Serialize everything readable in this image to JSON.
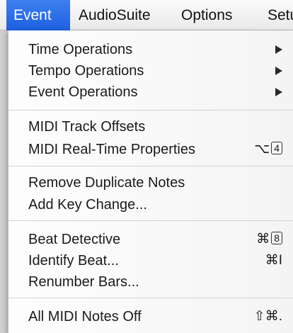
{
  "menubar": {
    "items": [
      {
        "label": "Event",
        "active": true
      },
      {
        "label": "AudioSuite",
        "active": false
      },
      {
        "label": "Options",
        "active": false
      },
      {
        "label": "Setu",
        "active": false
      }
    ]
  },
  "menu": {
    "title": "Event",
    "groups": [
      {
        "items": [
          {
            "label": "Time Operations",
            "submenu": true
          },
          {
            "label": "Tempo Operations",
            "submenu": true
          },
          {
            "label": "Event Operations",
            "submenu": true
          }
        ]
      },
      {
        "items": [
          {
            "label": "MIDI Track Offsets"
          },
          {
            "label": "MIDI Real-Time Properties",
            "shortcut_prefix": "⌥",
            "shortcut_key": "4",
            "shortcut_key_boxed": true
          }
        ]
      },
      {
        "items": [
          {
            "label": "Remove Duplicate Notes"
          },
          {
            "label": "Add Key Change..."
          }
        ]
      },
      {
        "items": [
          {
            "label": "Beat Detective",
            "shortcut_prefix": "⌘",
            "shortcut_key": "8",
            "shortcut_key_boxed": true
          },
          {
            "label": "Identify Beat...",
            "shortcut_prefix": "⌘",
            "shortcut_key": "I",
            "shortcut_key_boxed": false
          },
          {
            "label": "Renumber Bars..."
          }
        ]
      },
      {
        "items": [
          {
            "label": "All MIDI Notes Off",
            "shortcut_prefix": "⇧⌘.",
            "shortcut_key": "",
            "shortcut_key_boxed": false
          }
        ]
      }
    ]
  },
  "colors": {
    "highlight": "#2f6fe8",
    "menu_bg": "#f7f7f7",
    "text": "#1a1a1a"
  },
  "icons": {
    "submenu_arrow": "chevron-right-icon"
  }
}
